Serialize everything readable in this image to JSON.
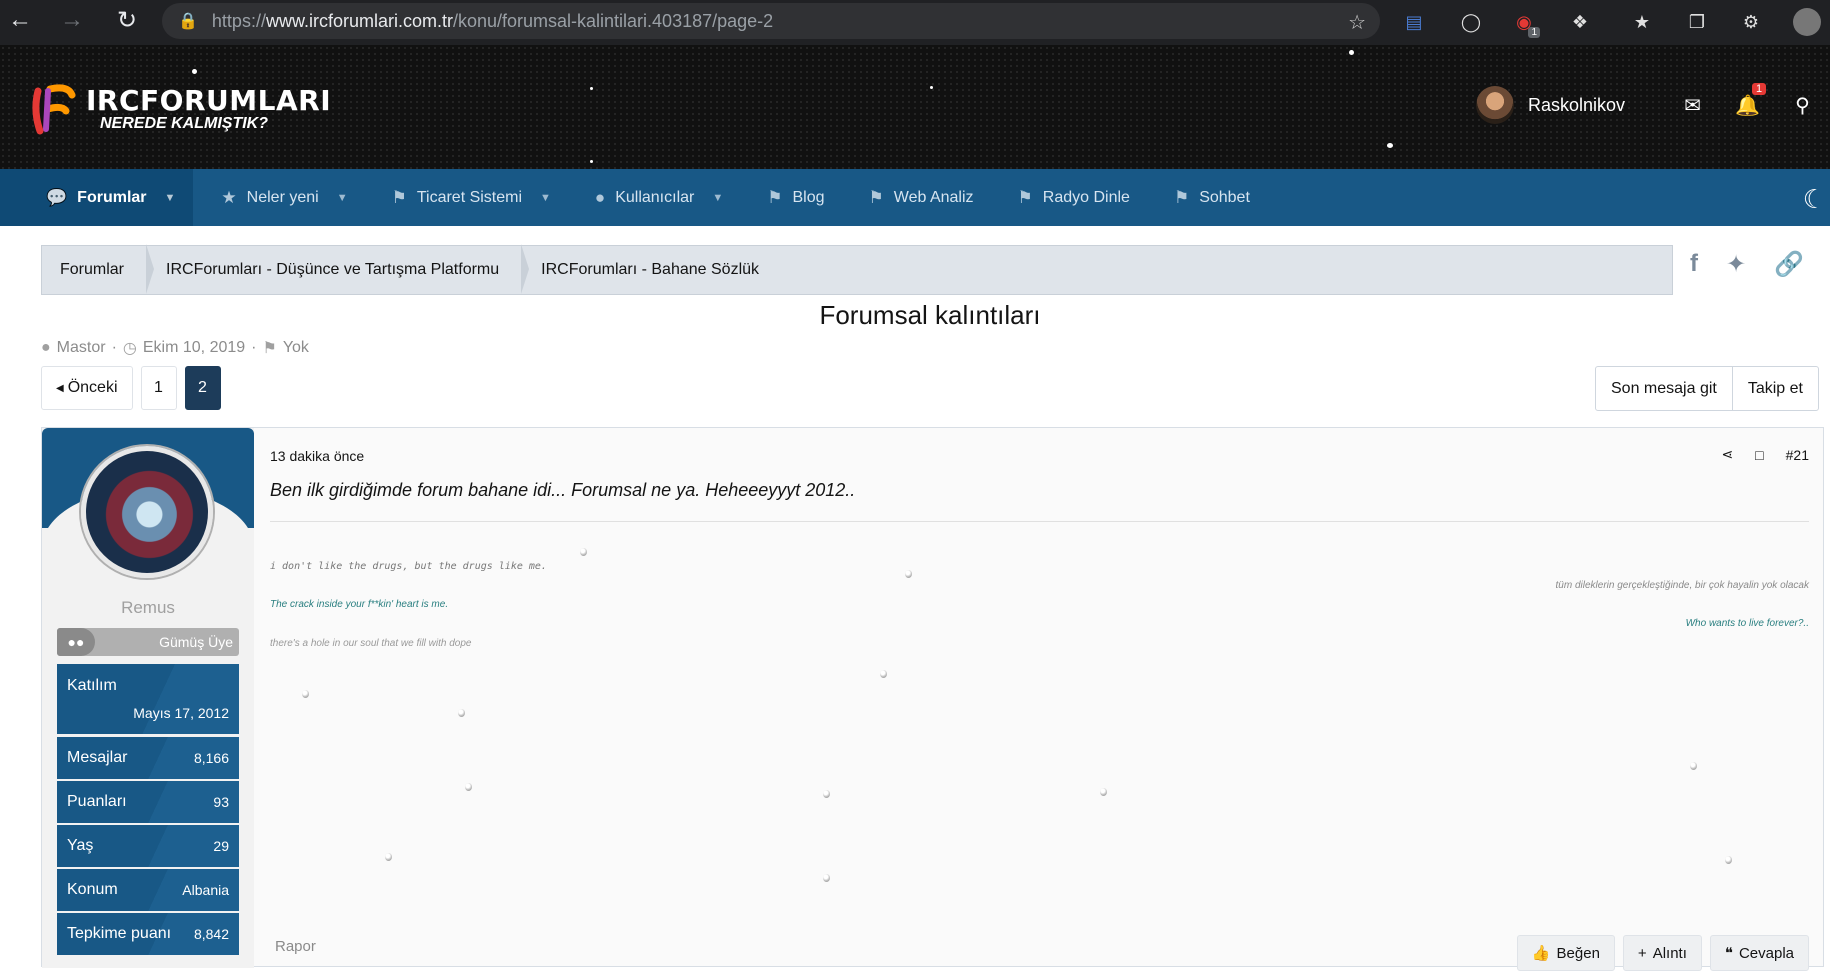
{
  "browser": {
    "url_prefix": "https://",
    "url_domain": "www.ircforumlari.com.tr",
    "url_path": "/konu/forumsal-kalintilari.403187/page-2"
  },
  "site": {
    "logo_title": "IRCFORUMLARI",
    "logo_subtitle": "NEREDE KALMIŞTIK?",
    "username": "Raskolnikov",
    "notification_count": "1"
  },
  "nav": {
    "items": [
      {
        "label": "Forumlar",
        "icon": "comments-icon"
      },
      {
        "label": "Neler yeni",
        "icon": "star-icon"
      },
      {
        "label": "Ticaret Sistemi",
        "icon": "tag-icon"
      },
      {
        "label": "Kullanıcılar",
        "icon": "user-icon"
      },
      {
        "label": "Blog",
        "icon": "tag-icon"
      },
      {
        "label": "Web Analiz",
        "icon": "tag-icon"
      },
      {
        "label": "Radyo Dinle",
        "icon": "tag-icon"
      },
      {
        "label": "Sohbet",
        "icon": "tag-icon"
      }
    ]
  },
  "breadcrumb": [
    "Forumlar",
    "IRCForumları - Düşünce ve Tartışma Platformu",
    "IRCForumları - Bahane Sözlük"
  ],
  "thread": {
    "title": "Forumsal kalıntıları",
    "author": "Mastor",
    "date": "Ekim 10, 2019",
    "tags": "Yok"
  },
  "pager": {
    "prev": "Önceki",
    "pages": [
      "1",
      "2"
    ],
    "current": "2",
    "last_post": "Son mesaja git",
    "follow": "Takip et"
  },
  "post": {
    "user": {
      "name": "Remus",
      "rank": "Gümüş Üye",
      "stats": [
        {
          "label": "Katılım",
          "value": "Mayıs 17, 2012"
        },
        {
          "label": "Mesajlar",
          "value": "8,166"
        },
        {
          "label": "Puanları",
          "value": "93"
        },
        {
          "label": "Yaş",
          "value": "29"
        },
        {
          "label": "Konum",
          "value": "Albania"
        },
        {
          "label": "Tepkime puanı",
          "value": "8,842"
        }
      ]
    },
    "time": "13 dakika önce",
    "number": "#21",
    "text": "Ben ilk girdiğimde forum bahane idi... Forumsal ne ya. Heheeeyyyt 2012..",
    "signature": [
      "i don't like the drugs, but the drugs like me.",
      "tüm dileklerin gerçekleştiğinde, bir çok hayalin yok olacak",
      "The crack inside your f**kin' heart is me.",
      "Who wants to live forever?..",
      "there's a hole in our soul that we fill with dope"
    ],
    "report": "Rapor",
    "like": "Beğen",
    "quote": "Alıntı",
    "reply": "Cevapla"
  }
}
